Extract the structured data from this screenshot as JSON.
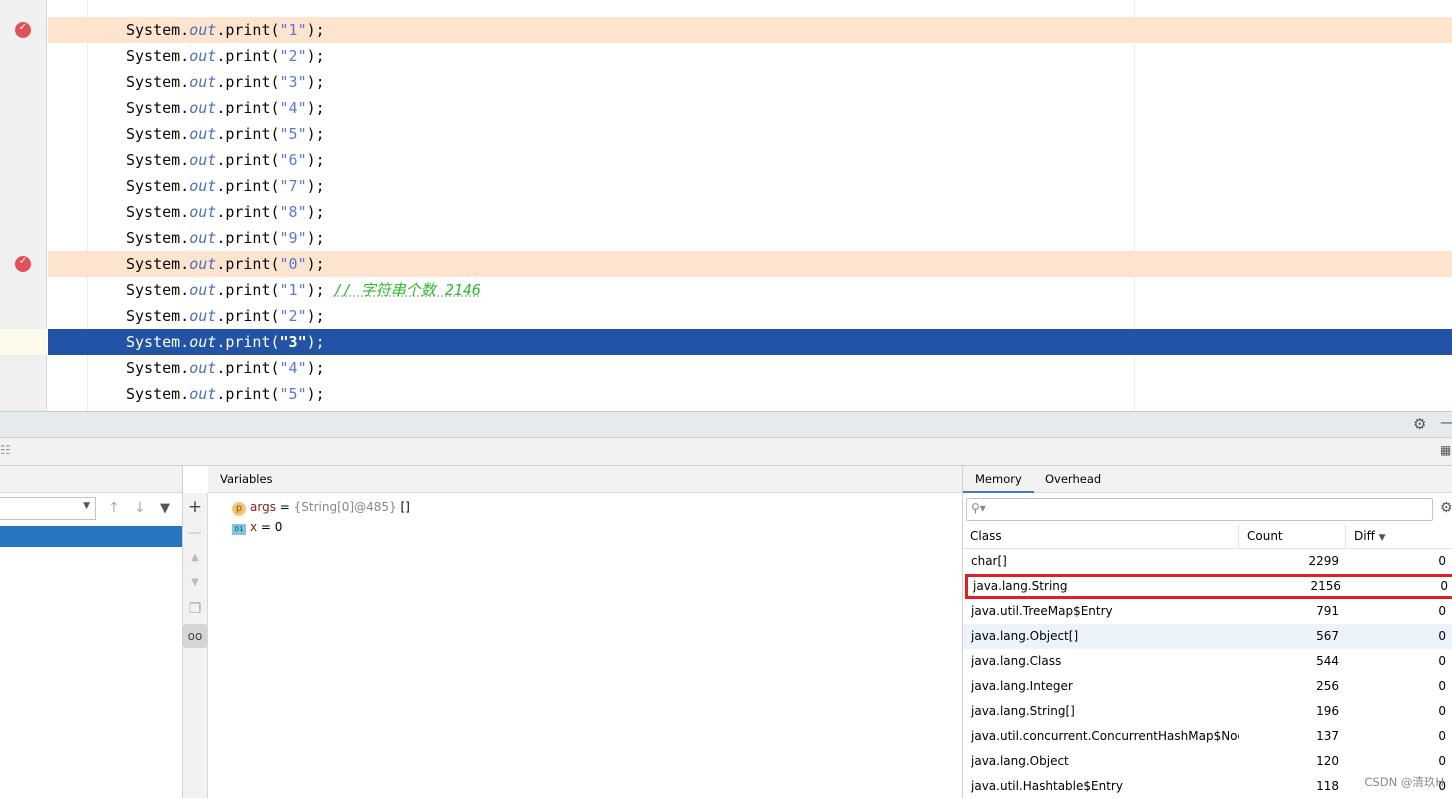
{
  "editor": {
    "lines": [
      {
        "prefix": "System.",
        "field": "out",
        "method": ".print(",
        "str": "\"1\"",
        "suffix": ");",
        "breakpoint": true
      },
      {
        "prefix": "System.",
        "field": "out",
        "method": ".print(",
        "str": "\"2\"",
        "suffix": ");"
      },
      {
        "prefix": "System.",
        "field": "out",
        "method": ".print(",
        "str": "\"3\"",
        "suffix": ");"
      },
      {
        "prefix": "System.",
        "field": "out",
        "method": ".print(",
        "str": "\"4\"",
        "suffix": ");"
      },
      {
        "prefix": "System.",
        "field": "out",
        "method": ".print(",
        "str": "\"5\"",
        "suffix": ");"
      },
      {
        "prefix": "System.",
        "field": "out",
        "method": ".print(",
        "str": "\"6\"",
        "suffix": ");"
      },
      {
        "prefix": "System.",
        "field": "out",
        "method": ".print(",
        "str": "\"7\"",
        "suffix": ");"
      },
      {
        "prefix": "System.",
        "field": "out",
        "method": ".print(",
        "str": "\"8\"",
        "suffix": ");"
      },
      {
        "prefix": "System.",
        "field": "out",
        "method": ".print(",
        "str": "\"9\"",
        "suffix": ");"
      },
      {
        "prefix": "System.",
        "field": "out",
        "method": ".print(",
        "str": "\"0\"",
        "suffix": ");",
        "breakpoint": true
      },
      {
        "prefix": "System.",
        "field": "out",
        "method": ".print(",
        "str": "\"1\"",
        "suffix": "); ",
        "comment": "// 字符串个数 2146"
      },
      {
        "prefix": "System.",
        "field": "out",
        "method": ".print(",
        "str": "\"2\"",
        "suffix": ");"
      },
      {
        "prefix": "System.",
        "field": "out",
        "method": ".print(",
        "str": "\"3\"",
        "suffix": ");",
        "current": true
      },
      {
        "prefix": "System.",
        "field": "out",
        "method": ".print(",
        "str": "\"4\"",
        "suffix": ");"
      },
      {
        "prefix": "System.",
        "field": "out",
        "method": ".print(",
        "str": "\"5\"",
        "suffix": ");"
      }
    ]
  },
  "variables": {
    "header": "Variables",
    "items": [
      {
        "badge": "p",
        "name": "args",
        "eq": " = ",
        "value": "{String[0]@485}",
        "extra": " []"
      },
      {
        "badge": "01",
        "name": "x",
        "eq": " = ",
        "value": "0",
        "extra": ""
      }
    ]
  },
  "memory": {
    "tabs": [
      "Memory",
      "Overhead"
    ],
    "active_tab": "Memory",
    "search_placeholder": "",
    "columns": [
      "Class",
      "Count",
      "Diff"
    ],
    "rows": [
      [
        "char[]",
        "2299",
        "0"
      ],
      [
        "java.lang.String",
        "2156",
        "0"
      ],
      [
        "java.util.TreeMap$Entry",
        "791",
        "0"
      ],
      [
        "java.lang.Object[]",
        "567",
        "0"
      ],
      [
        "java.lang.Class",
        "544",
        "0"
      ],
      [
        "java.lang.Integer",
        "256",
        "0"
      ],
      [
        "java.lang.String[]",
        "196",
        "0"
      ],
      [
        "java.util.concurrent.ConcurrentHashMap$Node",
        "137",
        "0"
      ],
      [
        "java.lang.Object",
        "120",
        "0"
      ],
      [
        "java.util.Hashtable$Entry",
        "118",
        "0"
      ]
    ],
    "highlighted_row": "java.lang.String",
    "highlight_color": "#e01e25"
  },
  "watermark": "CSDN @清玖H"
}
